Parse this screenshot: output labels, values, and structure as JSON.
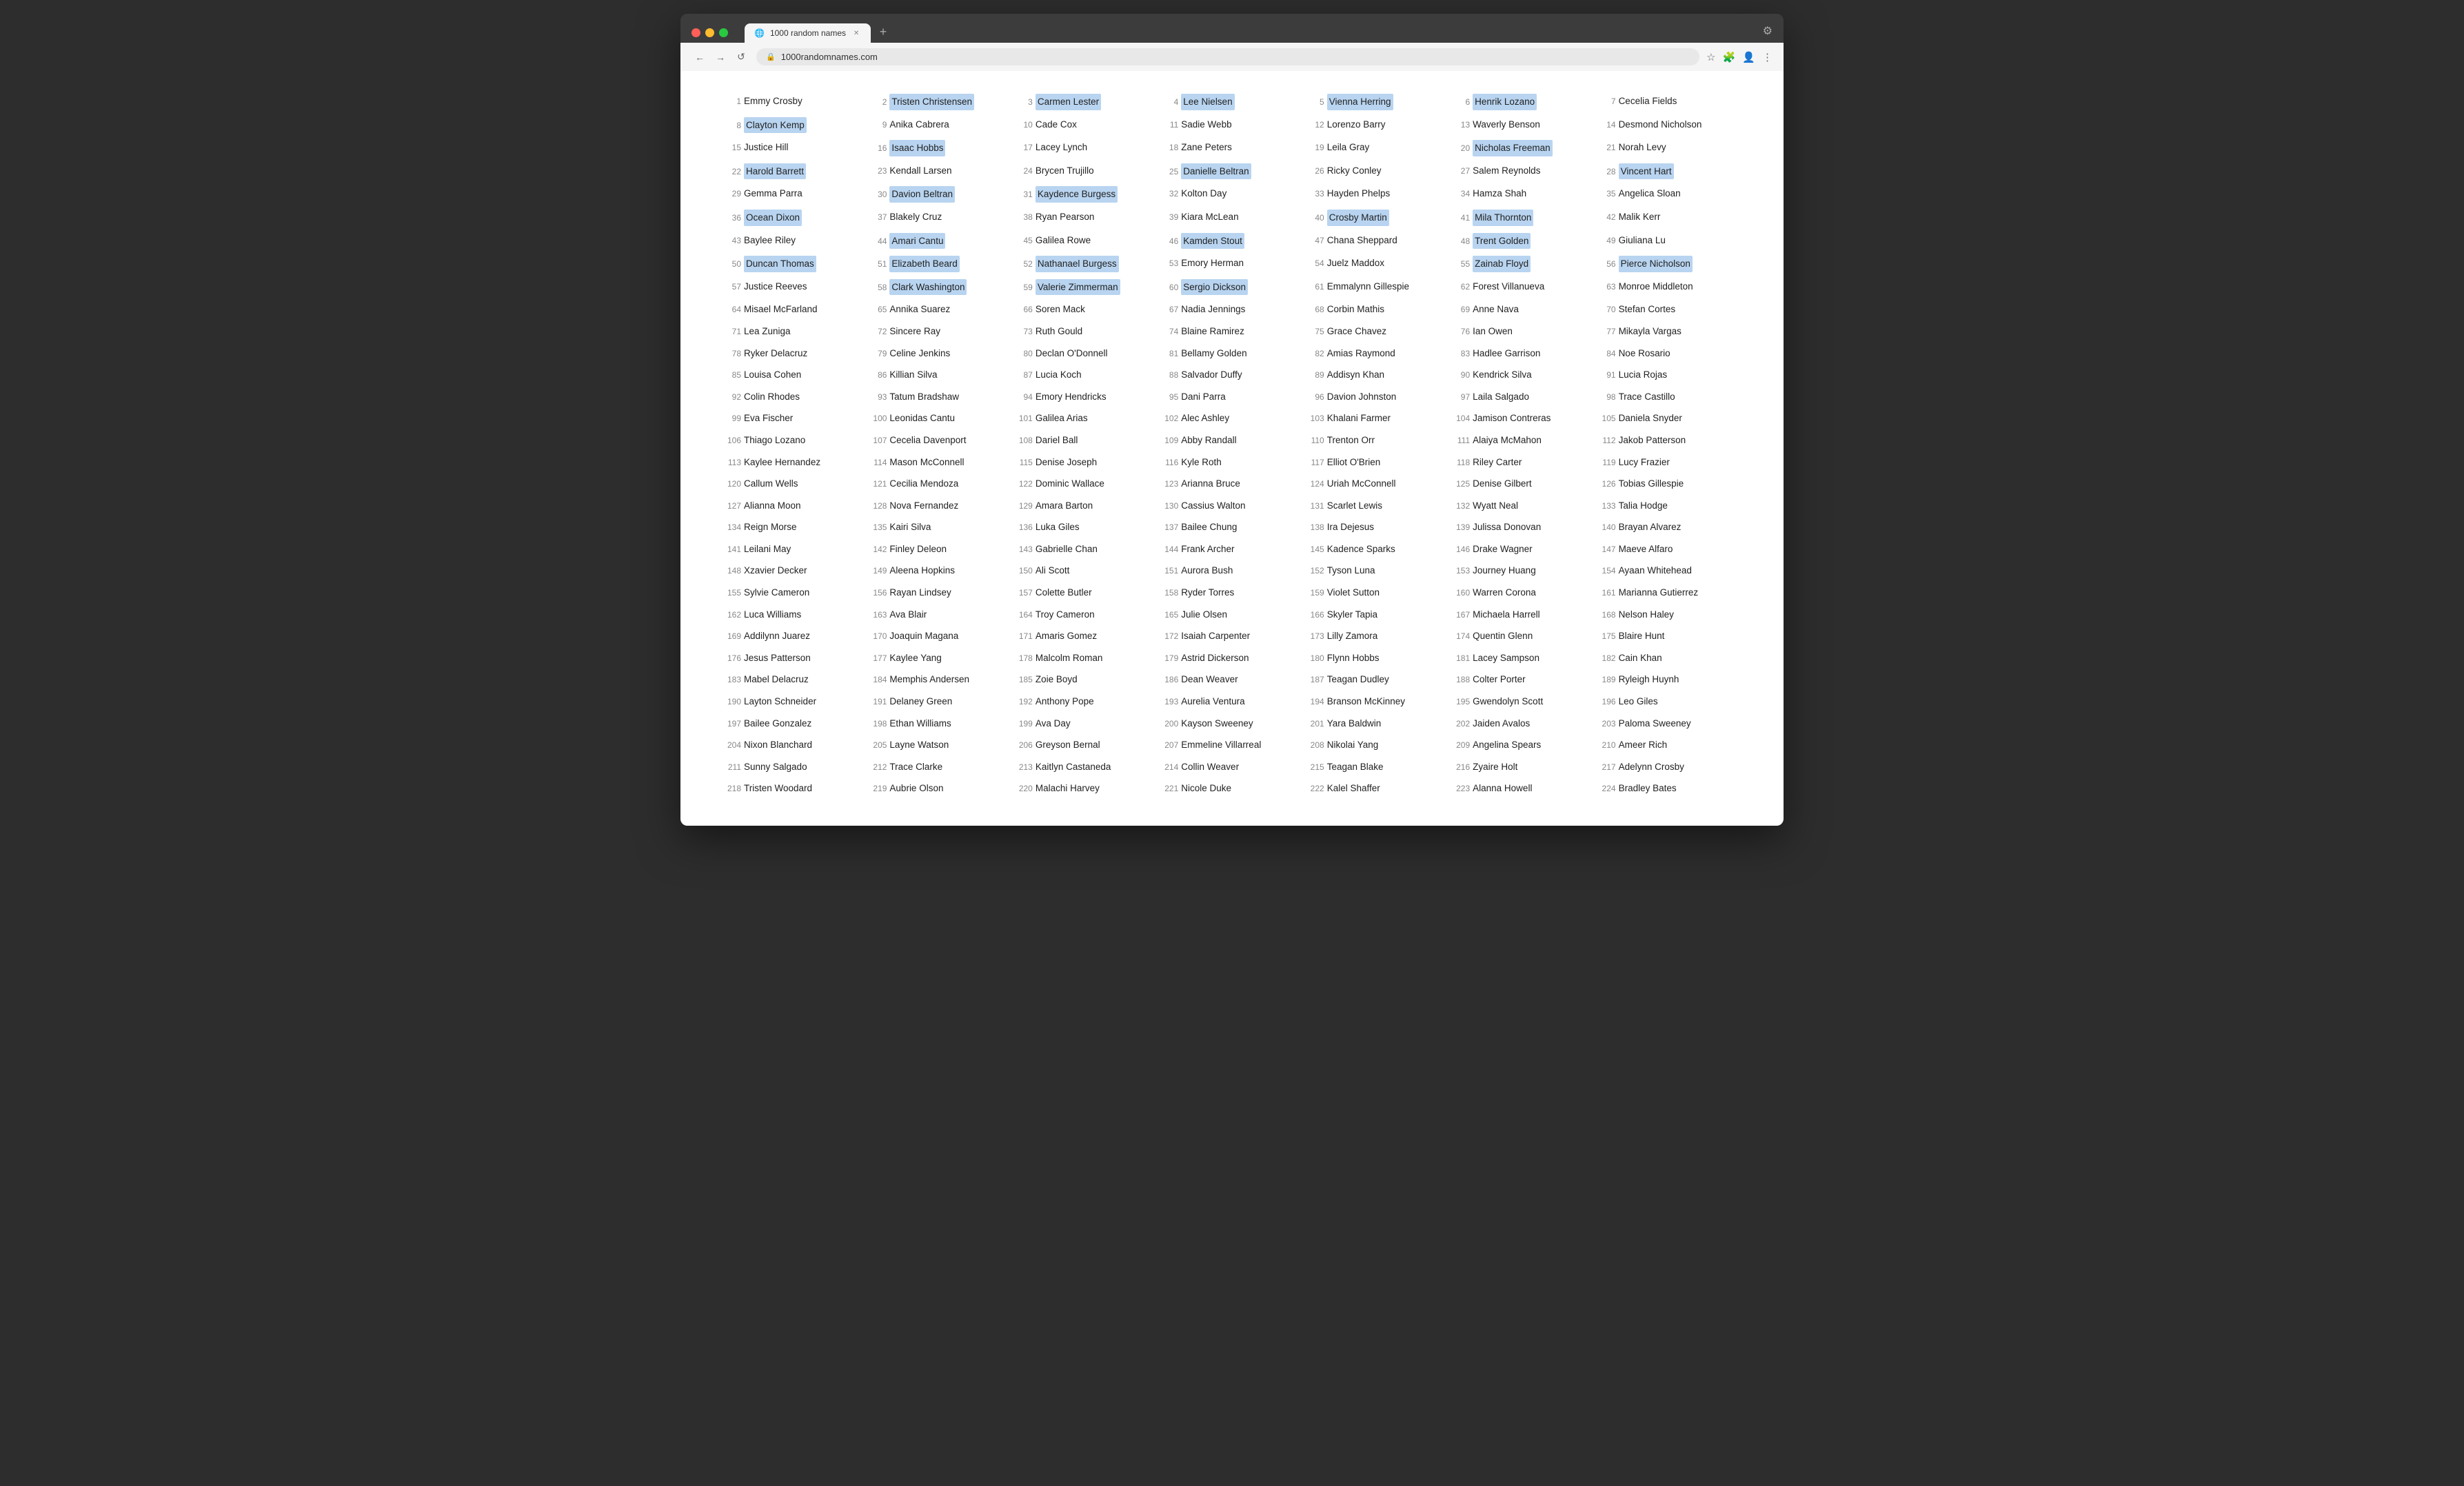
{
  "browser": {
    "tab_title": "1000 random names",
    "url": "1000randomnames.com",
    "nav": {
      "back": "←",
      "forward": "→",
      "refresh": "↺"
    }
  },
  "names": [
    {
      "num": 1,
      "name": "Emmy Crosby",
      "highlight": false
    },
    {
      "num": 2,
      "name": "Tristen Christensen",
      "highlight": true
    },
    {
      "num": 3,
      "name": "Carmen Lester",
      "highlight": true
    },
    {
      "num": 4,
      "name": "Lee Nielsen",
      "highlight": true
    },
    {
      "num": 5,
      "name": "Vienna Herring",
      "highlight": true
    },
    {
      "num": 6,
      "name": "Henrik Lozano",
      "highlight": true
    },
    {
      "num": 7,
      "name": "Cecelia Fields",
      "highlight": false
    },
    {
      "num": 8,
      "name": "Clayton Kemp",
      "highlight": true
    },
    {
      "num": 9,
      "name": "Anika Cabrera",
      "highlight": false
    },
    {
      "num": 10,
      "name": "Cade Cox",
      "highlight": false
    },
    {
      "num": 11,
      "name": "Sadie Webb",
      "highlight": false
    },
    {
      "num": 12,
      "name": "Lorenzo Barry",
      "highlight": false
    },
    {
      "num": 13,
      "name": "Waverly Benson",
      "highlight": false
    },
    {
      "num": 14,
      "name": "Desmond Nicholson",
      "highlight": false
    },
    {
      "num": 15,
      "name": "Justice Hill",
      "highlight": false
    },
    {
      "num": 16,
      "name": "Isaac Hobbs",
      "highlight": true
    },
    {
      "num": 17,
      "name": "Lacey Lynch",
      "highlight": false
    },
    {
      "num": 18,
      "name": "Zane Peters",
      "highlight": false
    },
    {
      "num": 19,
      "name": "Leila Gray",
      "highlight": false
    },
    {
      "num": 20,
      "name": "Nicholas Freeman",
      "highlight": true
    },
    {
      "num": 21,
      "name": "Norah Levy",
      "highlight": false
    },
    {
      "num": 22,
      "name": "Harold Barrett",
      "highlight": true
    },
    {
      "num": 23,
      "name": "Kendall Larsen",
      "highlight": false
    },
    {
      "num": 24,
      "name": "Brycen Trujillo",
      "highlight": false
    },
    {
      "num": 25,
      "name": "Danielle Beltran",
      "highlight": true
    },
    {
      "num": 26,
      "name": "Ricky Conley",
      "highlight": false
    },
    {
      "num": 27,
      "name": "Salem Reynolds",
      "highlight": false
    },
    {
      "num": 28,
      "name": "Vincent Hart",
      "highlight": true
    },
    {
      "num": 29,
      "name": "Gemma Parra",
      "highlight": false
    },
    {
      "num": 30,
      "name": "Davion Beltran",
      "highlight": true
    },
    {
      "num": 31,
      "name": "Kaydence Burgess",
      "highlight": true
    },
    {
      "num": 32,
      "name": "Kolton Day",
      "highlight": false
    },
    {
      "num": 33,
      "name": "Hayden Phelps",
      "highlight": false
    },
    {
      "num": 34,
      "name": "Hamza Shah",
      "highlight": false
    },
    {
      "num": 35,
      "name": "Angelica Sloan",
      "highlight": false
    },
    {
      "num": 36,
      "name": "Ocean Dixon",
      "highlight": true
    },
    {
      "num": 37,
      "name": "Blakely Cruz",
      "highlight": false
    },
    {
      "num": 38,
      "name": "Ryan Pearson",
      "highlight": false
    },
    {
      "num": 39,
      "name": "Kiara McLean",
      "highlight": false
    },
    {
      "num": 40,
      "name": "Crosby Martin",
      "highlight": true
    },
    {
      "num": 41,
      "name": "Mila Thornton",
      "highlight": true
    },
    {
      "num": 42,
      "name": "Malik Kerr",
      "highlight": false
    },
    {
      "num": 43,
      "name": "Baylee Riley",
      "highlight": false
    },
    {
      "num": 44,
      "name": "Amari Cantu",
      "highlight": true
    },
    {
      "num": 45,
      "name": "Galilea Rowe",
      "highlight": false
    },
    {
      "num": 46,
      "name": "Kamden Stout",
      "highlight": true
    },
    {
      "num": 47,
      "name": "Chana Sheppard",
      "highlight": false
    },
    {
      "num": 48,
      "name": "Trent Golden",
      "highlight": true
    },
    {
      "num": 49,
      "name": "Giuliana Lu",
      "highlight": false
    },
    {
      "num": 50,
      "name": "Duncan Thomas",
      "highlight": true
    },
    {
      "num": 51,
      "name": "Elizabeth Beard",
      "highlight": true
    },
    {
      "num": 52,
      "name": "Nathanael Burgess",
      "highlight": true
    },
    {
      "num": 53,
      "name": "Emory Herman",
      "highlight": false
    },
    {
      "num": 54,
      "name": "Juelz Maddox",
      "highlight": false
    },
    {
      "num": 55,
      "name": "Zainab Floyd",
      "highlight": true
    },
    {
      "num": 56,
      "name": "Pierce Nicholson",
      "highlight": true
    },
    {
      "num": 57,
      "name": "Justice Reeves",
      "highlight": false
    },
    {
      "num": 58,
      "name": "Clark Washington",
      "highlight": true
    },
    {
      "num": 59,
      "name": "Valerie Zimmerman",
      "highlight": true
    },
    {
      "num": 60,
      "name": "Sergio Dickson",
      "highlight": true
    },
    {
      "num": 61,
      "name": "Emmalynn Gillespie",
      "highlight": false
    },
    {
      "num": 62,
      "name": "Forest Villanueva",
      "highlight": false
    },
    {
      "num": 63,
      "name": "Monroe Middleton",
      "highlight": false
    },
    {
      "num": 64,
      "name": "Misael McFarland",
      "highlight": false
    },
    {
      "num": 65,
      "name": "Annika Suarez",
      "highlight": false
    },
    {
      "num": 66,
      "name": "Soren Mack",
      "highlight": false
    },
    {
      "num": 67,
      "name": "Nadia Jennings",
      "highlight": false
    },
    {
      "num": 68,
      "name": "Corbin Mathis",
      "highlight": false
    },
    {
      "num": 69,
      "name": "Anne Nava",
      "highlight": false
    },
    {
      "num": 70,
      "name": "Stefan Cortes",
      "highlight": false
    },
    {
      "num": 71,
      "name": "Lea Zuniga",
      "highlight": false
    },
    {
      "num": 72,
      "name": "Sincere Ray",
      "highlight": false
    },
    {
      "num": 73,
      "name": "Ruth Gould",
      "highlight": false
    },
    {
      "num": 74,
      "name": "Blaine Ramirez",
      "highlight": false
    },
    {
      "num": 75,
      "name": "Grace Chavez",
      "highlight": false
    },
    {
      "num": 76,
      "name": "Ian Owen",
      "highlight": false
    },
    {
      "num": 77,
      "name": "Mikayla Vargas",
      "highlight": false
    },
    {
      "num": 78,
      "name": "Ryker Delacruz",
      "highlight": false
    },
    {
      "num": 79,
      "name": "Celine Jenkins",
      "highlight": false
    },
    {
      "num": 80,
      "name": "Declan O'Donnell",
      "highlight": false
    },
    {
      "num": 81,
      "name": "Bellamy Golden",
      "highlight": false
    },
    {
      "num": 82,
      "name": "Amias Raymond",
      "highlight": false
    },
    {
      "num": 83,
      "name": "Hadlee Garrison",
      "highlight": false
    },
    {
      "num": 84,
      "name": "Noe Rosario",
      "highlight": false
    },
    {
      "num": 85,
      "name": "Louisa Cohen",
      "highlight": false
    },
    {
      "num": 86,
      "name": "Killian Silva",
      "highlight": false
    },
    {
      "num": 87,
      "name": "Lucia Koch",
      "highlight": false
    },
    {
      "num": 88,
      "name": "Salvador Duffy",
      "highlight": false
    },
    {
      "num": 89,
      "name": "Addisyn Khan",
      "highlight": false
    },
    {
      "num": 90,
      "name": "Kendrick Silva",
      "highlight": false
    },
    {
      "num": 91,
      "name": "Lucia Rojas",
      "highlight": false
    },
    {
      "num": 92,
      "name": "Colin Rhodes",
      "highlight": false
    },
    {
      "num": 93,
      "name": "Tatum Bradshaw",
      "highlight": false
    },
    {
      "num": 94,
      "name": "Emory Hendricks",
      "highlight": false
    },
    {
      "num": 95,
      "name": "Dani Parra",
      "highlight": false
    },
    {
      "num": 96,
      "name": "Davion Johnston",
      "highlight": false
    },
    {
      "num": 97,
      "name": "Laila Salgado",
      "highlight": false
    },
    {
      "num": 98,
      "name": "Trace Castillo",
      "highlight": false
    },
    {
      "num": 99,
      "name": "Eva Fischer",
      "highlight": false
    },
    {
      "num": 100,
      "name": "Leonidas Cantu",
      "highlight": false
    },
    {
      "num": 101,
      "name": "Galilea Arias",
      "highlight": false
    },
    {
      "num": 102,
      "name": "Alec Ashley",
      "highlight": false
    },
    {
      "num": 103,
      "name": "Khalani Farmer",
      "highlight": false
    },
    {
      "num": 104,
      "name": "Jamison Contreras",
      "highlight": false
    },
    {
      "num": 105,
      "name": "Daniela Snyder",
      "highlight": false
    },
    {
      "num": 106,
      "name": "Thiago Lozano",
      "highlight": false
    },
    {
      "num": 107,
      "name": "Cecelia Davenport",
      "highlight": false
    },
    {
      "num": 108,
      "name": "Dariel Ball",
      "highlight": false
    },
    {
      "num": 109,
      "name": "Abby Randall",
      "highlight": false
    },
    {
      "num": 110,
      "name": "Trenton Orr",
      "highlight": false
    },
    {
      "num": 111,
      "name": "Alaiya McMahon",
      "highlight": false
    },
    {
      "num": 112,
      "name": "Jakob Patterson",
      "highlight": false
    },
    {
      "num": 113,
      "name": "Kaylee Hernandez",
      "highlight": false
    },
    {
      "num": 114,
      "name": "Mason McConnell",
      "highlight": false
    },
    {
      "num": 115,
      "name": "Denise Joseph",
      "highlight": false
    },
    {
      "num": 116,
      "name": "Kyle Roth",
      "highlight": false
    },
    {
      "num": 117,
      "name": "Elliot O'Brien",
      "highlight": false
    },
    {
      "num": 118,
      "name": "Riley Carter",
      "highlight": false
    },
    {
      "num": 119,
      "name": "Lucy Frazier",
      "highlight": false
    },
    {
      "num": 120,
      "name": "Callum Wells",
      "highlight": false
    },
    {
      "num": 121,
      "name": "Cecilia Mendoza",
      "highlight": false
    },
    {
      "num": 122,
      "name": "Dominic Wallace",
      "highlight": false
    },
    {
      "num": 123,
      "name": "Arianna Bruce",
      "highlight": false
    },
    {
      "num": 124,
      "name": "Uriah McConnell",
      "highlight": false
    },
    {
      "num": 125,
      "name": "Denise Gilbert",
      "highlight": false
    },
    {
      "num": 126,
      "name": "Tobias Gillespie",
      "highlight": false
    },
    {
      "num": 127,
      "name": "Alianna Moon",
      "highlight": false
    },
    {
      "num": 128,
      "name": "Nova Fernandez",
      "highlight": false
    },
    {
      "num": 129,
      "name": "Amara Barton",
      "highlight": false
    },
    {
      "num": 130,
      "name": "Cassius Walton",
      "highlight": false
    },
    {
      "num": 131,
      "name": "Scarlet Lewis",
      "highlight": false
    },
    {
      "num": 132,
      "name": "Wyatt Neal",
      "highlight": false
    },
    {
      "num": 133,
      "name": "Talia Hodge",
      "highlight": false
    },
    {
      "num": 134,
      "name": "Reign Morse",
      "highlight": false
    },
    {
      "num": 135,
      "name": "Kairi Silva",
      "highlight": false
    },
    {
      "num": 136,
      "name": "Luka Giles",
      "highlight": false
    },
    {
      "num": 137,
      "name": "Bailee Chung",
      "highlight": false
    },
    {
      "num": 138,
      "name": "Ira Dejesus",
      "highlight": false
    },
    {
      "num": 139,
      "name": "Julissa Donovan",
      "highlight": false
    },
    {
      "num": 140,
      "name": "Brayan Alvarez",
      "highlight": false
    },
    {
      "num": 141,
      "name": "Leilani May",
      "highlight": false
    },
    {
      "num": 142,
      "name": "Finley Deleon",
      "highlight": false
    },
    {
      "num": 143,
      "name": "Gabrielle Chan",
      "highlight": false
    },
    {
      "num": 144,
      "name": "Frank Archer",
      "highlight": false
    },
    {
      "num": 145,
      "name": "Kadence Sparks",
      "highlight": false
    },
    {
      "num": 146,
      "name": "Drake Wagner",
      "highlight": false
    },
    {
      "num": 147,
      "name": "Maeve Alfaro",
      "highlight": false
    },
    {
      "num": 148,
      "name": "Xzavier Decker",
      "highlight": false
    },
    {
      "num": 149,
      "name": "Aleena Hopkins",
      "highlight": false
    },
    {
      "num": 150,
      "name": "Ali Scott",
      "highlight": false
    },
    {
      "num": 151,
      "name": "Aurora Bush",
      "highlight": false
    },
    {
      "num": 152,
      "name": "Tyson Luna",
      "highlight": false
    },
    {
      "num": 153,
      "name": "Journey Huang",
      "highlight": false
    },
    {
      "num": 154,
      "name": "Ayaan Whitehead",
      "highlight": false
    },
    {
      "num": 155,
      "name": "Sylvie Cameron",
      "highlight": false
    },
    {
      "num": 156,
      "name": "Rayan Lindsey",
      "highlight": false
    },
    {
      "num": 157,
      "name": "Colette Butler",
      "highlight": false
    },
    {
      "num": 158,
      "name": "Ryder Torres",
      "highlight": false
    },
    {
      "num": 159,
      "name": "Violet Sutton",
      "highlight": false
    },
    {
      "num": 160,
      "name": "Warren Corona",
      "highlight": false
    },
    {
      "num": 161,
      "name": "Marianna Gutierrez",
      "highlight": false
    },
    {
      "num": 162,
      "name": "Luca Williams",
      "highlight": false
    },
    {
      "num": 163,
      "name": "Ava Blair",
      "highlight": false
    },
    {
      "num": 164,
      "name": "Troy Cameron",
      "highlight": false
    },
    {
      "num": 165,
      "name": "Julie Olsen",
      "highlight": false
    },
    {
      "num": 166,
      "name": "Skyler Tapia",
      "highlight": false
    },
    {
      "num": 167,
      "name": "Michaela Harrell",
      "highlight": false
    },
    {
      "num": 168,
      "name": "Nelson Haley",
      "highlight": false
    },
    {
      "num": 169,
      "name": "Addilynn Juarez",
      "highlight": false
    },
    {
      "num": 170,
      "name": "Joaquin Magana",
      "highlight": false
    },
    {
      "num": 171,
      "name": "Amaris Gomez",
      "highlight": false
    },
    {
      "num": 172,
      "name": "Isaiah Carpenter",
      "highlight": false
    },
    {
      "num": 173,
      "name": "Lilly Zamora",
      "highlight": false
    },
    {
      "num": 174,
      "name": "Quentin Glenn",
      "highlight": false
    },
    {
      "num": 175,
      "name": "Blaire Hunt",
      "highlight": false
    },
    {
      "num": 176,
      "name": "Jesus Patterson",
      "highlight": false
    },
    {
      "num": 177,
      "name": "Kaylee Yang",
      "highlight": false
    },
    {
      "num": 178,
      "name": "Malcolm Roman",
      "highlight": false
    },
    {
      "num": 179,
      "name": "Astrid Dickerson",
      "highlight": false
    },
    {
      "num": 180,
      "name": "Flynn Hobbs",
      "highlight": false
    },
    {
      "num": 181,
      "name": "Lacey Sampson",
      "highlight": false
    },
    {
      "num": 182,
      "name": "Cain Khan",
      "highlight": false
    },
    {
      "num": 183,
      "name": "Mabel Delacruz",
      "highlight": false
    },
    {
      "num": 184,
      "name": "Memphis Andersen",
      "highlight": false
    },
    {
      "num": 185,
      "name": "Zoie Boyd",
      "highlight": false
    },
    {
      "num": 186,
      "name": "Dean Weaver",
      "highlight": false
    },
    {
      "num": 187,
      "name": "Teagan Dudley",
      "highlight": false
    },
    {
      "num": 188,
      "name": "Colter Porter",
      "highlight": false
    },
    {
      "num": 189,
      "name": "Ryleigh Huynh",
      "highlight": false
    },
    {
      "num": 190,
      "name": "Layton Schneider",
      "highlight": false
    },
    {
      "num": 191,
      "name": "Delaney Green",
      "highlight": false
    },
    {
      "num": 192,
      "name": "Anthony Pope",
      "highlight": false
    },
    {
      "num": 193,
      "name": "Aurelia Ventura",
      "highlight": false
    },
    {
      "num": 194,
      "name": "Branson McKinney",
      "highlight": false
    },
    {
      "num": 195,
      "name": "Gwendolyn Scott",
      "highlight": false
    },
    {
      "num": 196,
      "name": "Leo Giles",
      "highlight": false
    },
    {
      "num": 197,
      "name": "Bailee Gonzalez",
      "highlight": false
    },
    {
      "num": 198,
      "name": "Ethan Williams",
      "highlight": false
    },
    {
      "num": 199,
      "name": "Ava Day",
      "highlight": false
    },
    {
      "num": 200,
      "name": "Kayson Sweeney",
      "highlight": false
    },
    {
      "num": 201,
      "name": "Yara Baldwin",
      "highlight": false
    },
    {
      "num": 202,
      "name": "Jaiden Avalos",
      "highlight": false
    },
    {
      "num": 203,
      "name": "Paloma Sweeney",
      "highlight": false
    },
    {
      "num": 204,
      "name": "Nixon Blanchard",
      "highlight": false
    },
    {
      "num": 205,
      "name": "Layne Watson",
      "highlight": false
    },
    {
      "num": 206,
      "name": "Greyson Bernal",
      "highlight": false
    },
    {
      "num": 207,
      "name": "Emmeline Villarreal",
      "highlight": false
    },
    {
      "num": 208,
      "name": "Nikolai Yang",
      "highlight": false
    },
    {
      "num": 209,
      "name": "Angelina Spears",
      "highlight": false
    },
    {
      "num": 210,
      "name": "Ameer Rich",
      "highlight": false
    },
    {
      "num": 211,
      "name": "Sunny Salgado",
      "highlight": false
    },
    {
      "num": 212,
      "name": "Trace Clarke",
      "highlight": false
    },
    {
      "num": 213,
      "name": "Kaitlyn Castaneda",
      "highlight": false
    },
    {
      "num": 214,
      "name": "Collin Weaver",
      "highlight": false
    },
    {
      "num": 215,
      "name": "Teagan Blake",
      "highlight": false
    },
    {
      "num": 216,
      "name": "Zyaire Holt",
      "highlight": false
    },
    {
      "num": 217,
      "name": "Adelynn Crosby",
      "highlight": false
    },
    {
      "num": 218,
      "name": "Tristen Woodard",
      "highlight": false
    },
    {
      "num": 219,
      "name": "Aubrie Olson",
      "highlight": false
    },
    {
      "num": 220,
      "name": "Malachi Harvey",
      "highlight": false
    },
    {
      "num": 221,
      "name": "Nicole Duke",
      "highlight": false
    },
    {
      "num": 222,
      "name": "Kalel Shaffer",
      "highlight": false
    },
    {
      "num": 223,
      "name": "Alanna Howell",
      "highlight": false
    },
    {
      "num": 224,
      "name": "Bradley Bates",
      "highlight": false
    }
  ]
}
